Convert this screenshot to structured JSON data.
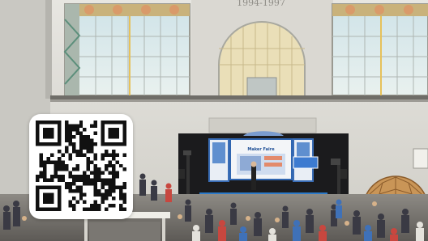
{
  "scene": {
    "facade_inscription": "1994-1997",
    "stage_screen_heading": "Maker Faire",
    "qr_code": {
      "visible": true,
      "target": "not legible"
    }
  }
}
